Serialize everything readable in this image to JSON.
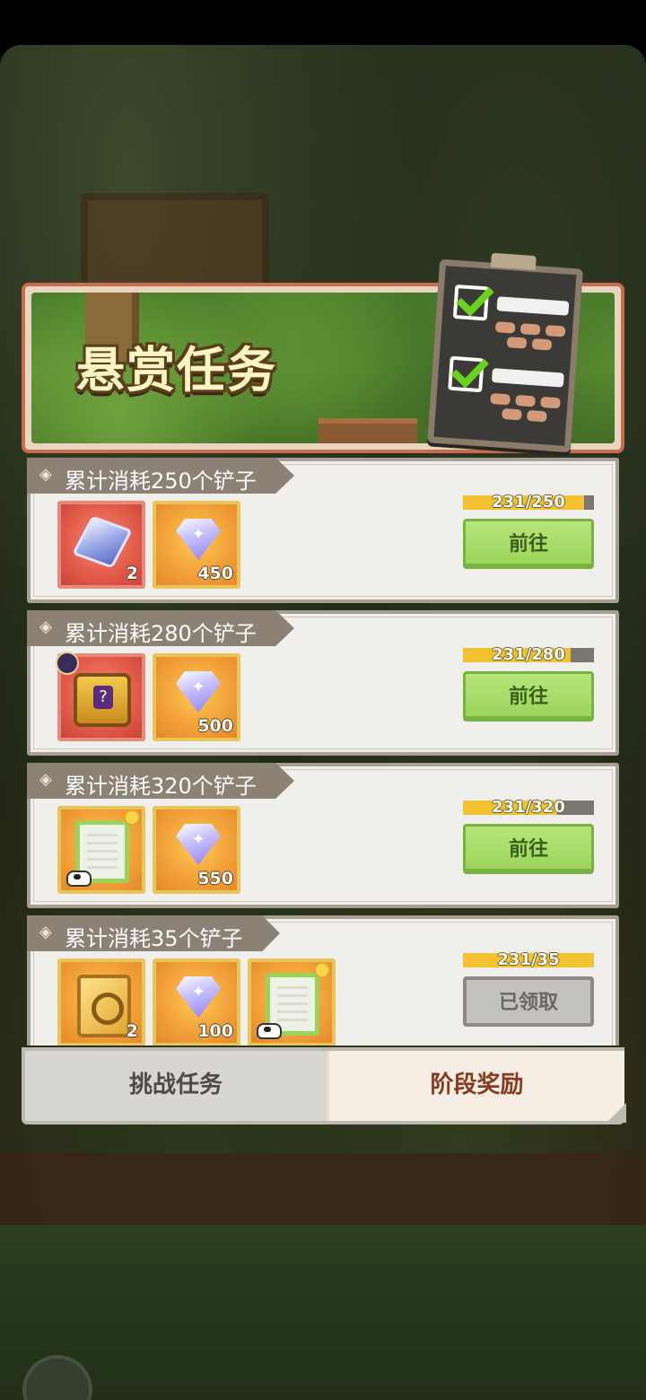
{
  "window": {
    "title": "悬赏任务"
  },
  "tasks": [
    {
      "title": "累计消耗250个铲子",
      "rewards": [
        {
          "icon": "crystal-cube-icon",
          "count": "2",
          "frame": "red"
        },
        {
          "icon": "diamond-gem-icon",
          "count": "450",
          "frame": "gold"
        }
      ],
      "progress_text": "231/250",
      "progress_value": 231,
      "progress_max": 250,
      "button_label": "前往",
      "button_state": "go"
    },
    {
      "title": "累计消耗280个铲子",
      "rewards": [
        {
          "icon": "mystery-chest-icon",
          "count": "",
          "frame": "red"
        },
        {
          "icon": "diamond-gem-icon",
          "count": "500",
          "frame": "gold"
        }
      ],
      "progress_text": "231/280",
      "progress_value": 231,
      "progress_max": 280,
      "button_label": "前往",
      "button_state": "go"
    },
    {
      "title": "累计消耗320个铲子",
      "rewards": [
        {
          "icon": "scroll-icon",
          "count": "",
          "frame": "gold"
        },
        {
          "icon": "diamond-gem-icon",
          "count": "550",
          "frame": "gold"
        }
      ],
      "progress_text": "231/320",
      "progress_value": 231,
      "progress_max": 320,
      "button_label": "前往",
      "button_state": "go"
    },
    {
      "title": "累计消耗35个铲子",
      "rewards": [
        {
          "icon": "gold-book-icon",
          "count": "2",
          "frame": "gold"
        },
        {
          "icon": "diamond-gem-icon",
          "count": "100",
          "frame": "gold"
        },
        {
          "icon": "scroll-icon",
          "count": "",
          "frame": "gold"
        }
      ],
      "progress_text": "231/35",
      "progress_value": 35,
      "progress_max": 35,
      "button_label": "已领取",
      "button_state": "claimed"
    }
  ],
  "tabs": {
    "challenge": "挑战任务",
    "stage_rewards": "阶段奖励",
    "active": "stage_rewards"
  },
  "colors": {
    "progress_fill": "#f2c230",
    "go_button": "#9cd55b",
    "claimed_button": "#c3c1bd",
    "active_tab_text": "#8a3b1f"
  }
}
